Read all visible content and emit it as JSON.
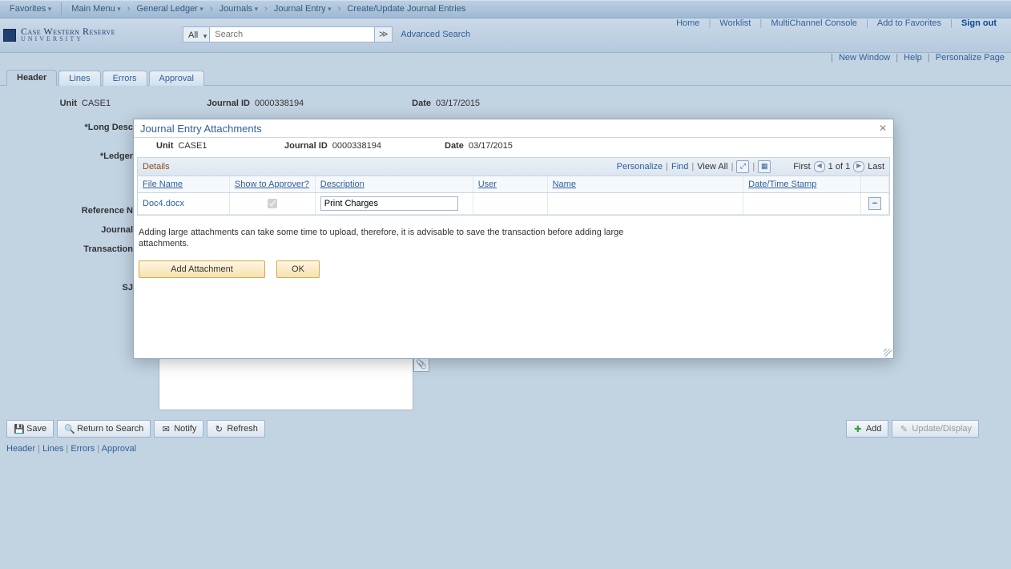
{
  "topmenu": {
    "favorites": "Favorites",
    "mainmenu": "Main Menu",
    "crumbs": [
      "General Ledger",
      "Journals",
      "Journal Entry",
      "Create/Update Journal Entries"
    ]
  },
  "logo": {
    "line1": "Case Western Reserve",
    "line2": "UNIVERSITY"
  },
  "search": {
    "scope": "All",
    "placeholder": "Search",
    "advanced": "Advanced Search"
  },
  "toplinks": {
    "home": "Home",
    "worklist": "Worklist",
    "multichannel": "MultiChannel Console",
    "addfav": "Add to Favorites",
    "signout": "Sign out"
  },
  "utillinks": {
    "newwindow": "New Window",
    "help": "Help",
    "person": "Personalize Page"
  },
  "tabs": [
    "Header",
    "Lines",
    "Errors",
    "Approval"
  ],
  "bgform": {
    "unit_lbl": "Unit",
    "unit_val": "CASE1",
    "jid_lbl": "Journal ID",
    "jid_val": "0000338194",
    "date_lbl": "Date",
    "date_val": "03/17/2015",
    "longd_lbl": "*Long Desc",
    "ledger_lbl": "*Ledger",
    "ref_lbl": "Reference N",
    "jr_lbl": "Journal",
    "trans_lbl": "Transaction",
    "sj_lbl": "SJ"
  },
  "modal": {
    "title": "Journal Entry Attachments",
    "unit_lbl": "Unit",
    "unit_val": "CASE1",
    "jid_lbl": "Journal ID",
    "jid_val": "0000338194",
    "date_lbl": "Date",
    "date_val": "03/17/2015",
    "details_title": "Details",
    "personalize": "Personalize",
    "find": "Find",
    "viewall": "View All",
    "first": "First",
    "count": "1 of 1",
    "last": "Last",
    "cols": {
      "filename": "File Name",
      "show": "Show to Approver?",
      "desc": "Description",
      "user": "User",
      "name": "Name",
      "dts": "Date/Time Stamp"
    },
    "row": {
      "filename": "Doc4.docx",
      "show": true,
      "desc": "Print Charges",
      "user": "",
      "name": "",
      "dts": ""
    },
    "hint": "Adding large attachments can take some time to upload, therefore, it is advisable to save the transaction before adding large attachments.",
    "add": "Add Attachment",
    "ok": "OK"
  },
  "bottom": {
    "save": "Save",
    "return": "Return to Search",
    "notify": "Notify",
    "refresh": "Refresh",
    "add": "Add",
    "update": "Update/Display"
  },
  "footlinks": [
    "Header",
    "Lines",
    "Errors",
    "Approval"
  ]
}
